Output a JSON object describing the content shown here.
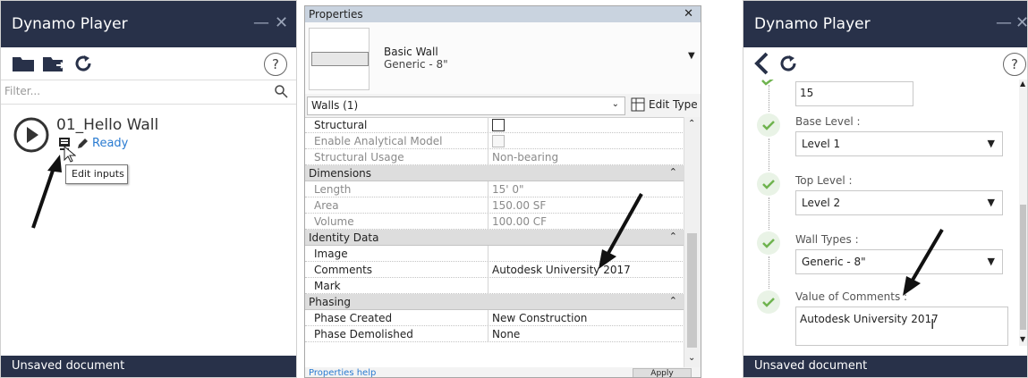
{
  "left_player": {
    "title": "Dynamo Player",
    "filter_placeholder": "Filter...",
    "script_name": "01_Hello Wall",
    "status": "Ready",
    "tooltip": "Edit inputs",
    "status_bar": "Unsaved document"
  },
  "properties": {
    "title": "Properties",
    "type_family": "Basic Wall",
    "type_name": "Generic - 8\"",
    "filter_value": "Walls (1)",
    "edit_type_label": "Edit Type",
    "rows": [
      {
        "kind": "param",
        "label": "Structural",
        "value": ""
      },
      {
        "kind": "param",
        "label": "Enable Analytical Model",
        "value": ""
      },
      {
        "kind": "param",
        "label": "Structural Usage",
        "value": "Non-bearing"
      },
      {
        "kind": "group",
        "label": "Dimensions"
      },
      {
        "kind": "param",
        "label": "Length",
        "value": "15'  0\""
      },
      {
        "kind": "param",
        "label": "Area",
        "value": "150.00 SF"
      },
      {
        "kind": "param",
        "label": "Volume",
        "value": "100.00 CF"
      },
      {
        "kind": "group",
        "label": "Identity Data"
      },
      {
        "kind": "param",
        "label": "Image",
        "value": ""
      },
      {
        "kind": "param",
        "label": "Comments",
        "value": "Autodesk University 2017"
      },
      {
        "kind": "param",
        "label": "Mark",
        "value": ""
      },
      {
        "kind": "group",
        "label": "Phasing"
      },
      {
        "kind": "param",
        "label": "Phase Created",
        "value": "New Construction"
      },
      {
        "kind": "param",
        "label": "Phase Demolished",
        "value": "None"
      }
    ],
    "footer_link": "Properties help",
    "apply_label": "Apply"
  },
  "right_player": {
    "title": "Dynamo Player",
    "top_value": "15",
    "base_level_label": "Base Level :",
    "base_level_value": "Level 1",
    "top_level_label": "Top Level :",
    "top_level_value": "Level 2",
    "wall_types_label": "Wall Types :",
    "wall_types_value": "Generic - 8\"",
    "comments_label": "Value of Comments :",
    "comments_value": "Autodesk University 2017",
    "status_bar": "Unsaved document"
  },
  "colors": {
    "title_bar": "#283149",
    "link_blue": "#2a7bd1",
    "check_green": "#6fb34f"
  }
}
